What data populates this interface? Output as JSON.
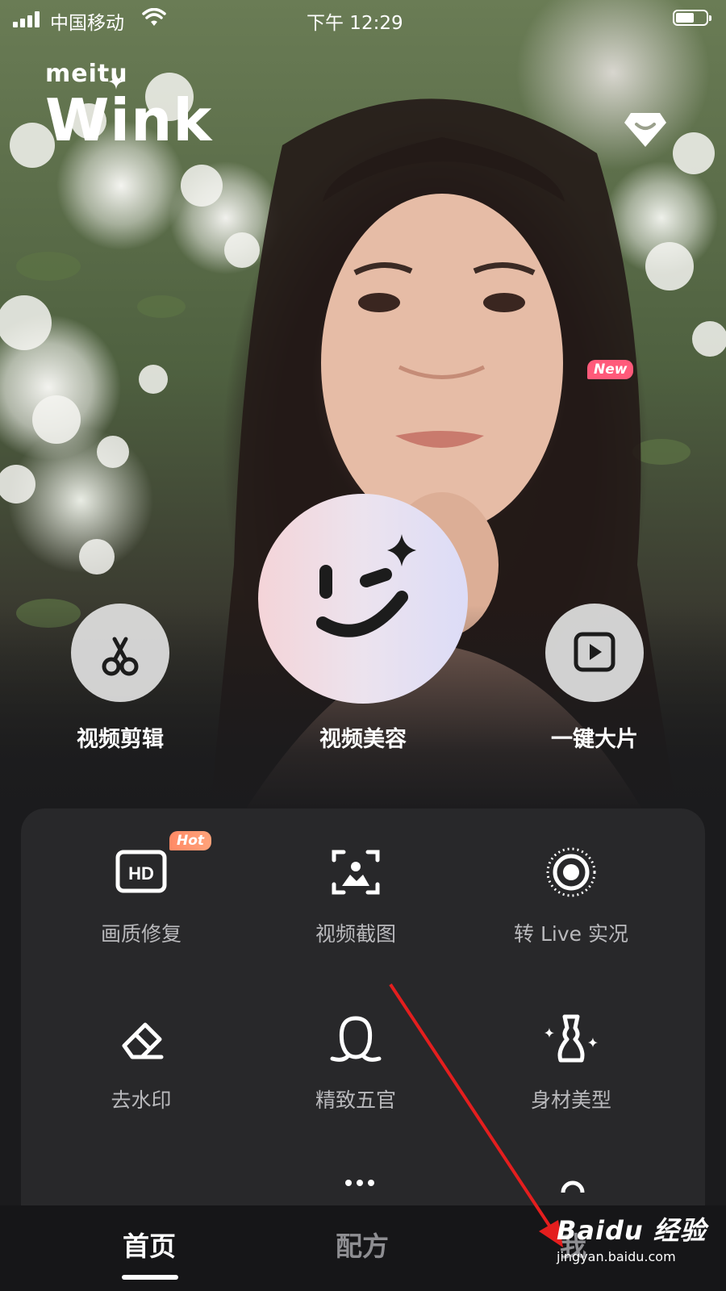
{
  "status_bar": {
    "carrier": "中国移动",
    "time": "下午 12:29",
    "battery_level": 0.6
  },
  "logo": {
    "brand": "meitu",
    "app": "Wink"
  },
  "actions": {
    "video_edit": "视频剪辑",
    "video_beauty": "视频美容",
    "one_click": "一键大片"
  },
  "tools": [
    {
      "label": "画质修复",
      "icon": "hd-icon",
      "badge": "Hot"
    },
    {
      "label": "视频截图",
      "icon": "screenshot-icon"
    },
    {
      "label": "转 Live 实况",
      "icon": "live-photo-icon"
    },
    {
      "label": "去水印",
      "icon": "eraser-icon"
    },
    {
      "label": "精致五官",
      "icon": "face-icon"
    },
    {
      "label": "身材美型",
      "icon": "body-shape-icon"
    }
  ],
  "badges": {
    "hot": "Hot",
    "new": "New"
  },
  "tab_bar": {
    "home": "首页",
    "recipe": "配方",
    "mine": "我"
  },
  "watermark": {
    "main": "Baidu 经验",
    "sub": "jingyan.baidu.com"
  },
  "colors": {
    "accent_hot": "#ff8a66",
    "accent_new": "#ff5a7a",
    "annotation_arrow": "#e41e1e"
  }
}
